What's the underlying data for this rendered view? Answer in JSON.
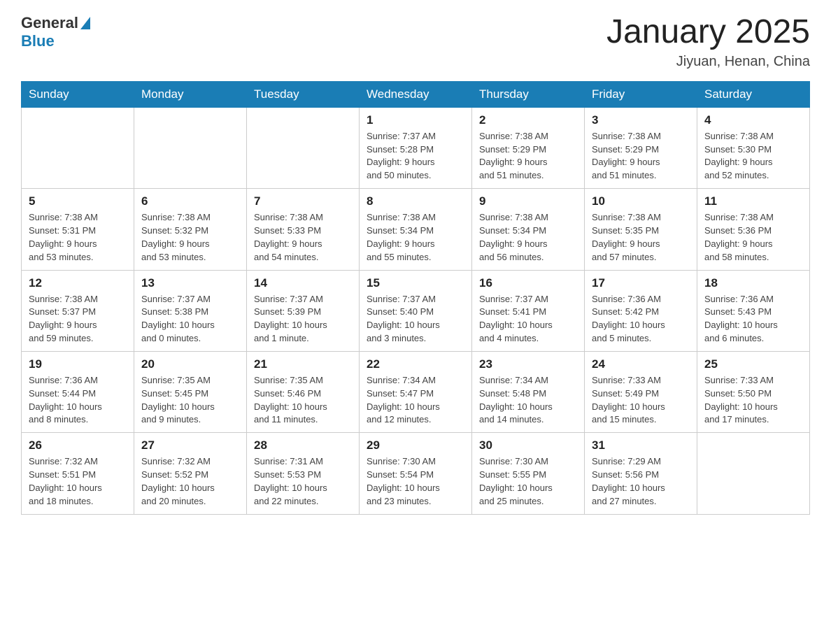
{
  "header": {
    "logo_general": "General",
    "logo_blue": "Blue",
    "title": "January 2025",
    "subtitle": "Jiyuan, Henan, China"
  },
  "weekdays": [
    "Sunday",
    "Monday",
    "Tuesday",
    "Wednesday",
    "Thursday",
    "Friday",
    "Saturday"
  ],
  "weeks": [
    [
      {
        "day": "",
        "info": ""
      },
      {
        "day": "",
        "info": ""
      },
      {
        "day": "",
        "info": ""
      },
      {
        "day": "1",
        "info": "Sunrise: 7:37 AM\nSunset: 5:28 PM\nDaylight: 9 hours\nand 50 minutes."
      },
      {
        "day": "2",
        "info": "Sunrise: 7:38 AM\nSunset: 5:29 PM\nDaylight: 9 hours\nand 51 minutes."
      },
      {
        "day": "3",
        "info": "Sunrise: 7:38 AM\nSunset: 5:29 PM\nDaylight: 9 hours\nand 51 minutes."
      },
      {
        "day": "4",
        "info": "Sunrise: 7:38 AM\nSunset: 5:30 PM\nDaylight: 9 hours\nand 52 minutes."
      }
    ],
    [
      {
        "day": "5",
        "info": "Sunrise: 7:38 AM\nSunset: 5:31 PM\nDaylight: 9 hours\nand 53 minutes."
      },
      {
        "day": "6",
        "info": "Sunrise: 7:38 AM\nSunset: 5:32 PM\nDaylight: 9 hours\nand 53 minutes."
      },
      {
        "day": "7",
        "info": "Sunrise: 7:38 AM\nSunset: 5:33 PM\nDaylight: 9 hours\nand 54 minutes."
      },
      {
        "day": "8",
        "info": "Sunrise: 7:38 AM\nSunset: 5:34 PM\nDaylight: 9 hours\nand 55 minutes."
      },
      {
        "day": "9",
        "info": "Sunrise: 7:38 AM\nSunset: 5:34 PM\nDaylight: 9 hours\nand 56 minutes."
      },
      {
        "day": "10",
        "info": "Sunrise: 7:38 AM\nSunset: 5:35 PM\nDaylight: 9 hours\nand 57 minutes."
      },
      {
        "day": "11",
        "info": "Sunrise: 7:38 AM\nSunset: 5:36 PM\nDaylight: 9 hours\nand 58 minutes."
      }
    ],
    [
      {
        "day": "12",
        "info": "Sunrise: 7:38 AM\nSunset: 5:37 PM\nDaylight: 9 hours\nand 59 minutes."
      },
      {
        "day": "13",
        "info": "Sunrise: 7:37 AM\nSunset: 5:38 PM\nDaylight: 10 hours\nand 0 minutes."
      },
      {
        "day": "14",
        "info": "Sunrise: 7:37 AM\nSunset: 5:39 PM\nDaylight: 10 hours\nand 1 minute."
      },
      {
        "day": "15",
        "info": "Sunrise: 7:37 AM\nSunset: 5:40 PM\nDaylight: 10 hours\nand 3 minutes."
      },
      {
        "day": "16",
        "info": "Sunrise: 7:37 AM\nSunset: 5:41 PM\nDaylight: 10 hours\nand 4 minutes."
      },
      {
        "day": "17",
        "info": "Sunrise: 7:36 AM\nSunset: 5:42 PM\nDaylight: 10 hours\nand 5 minutes."
      },
      {
        "day": "18",
        "info": "Sunrise: 7:36 AM\nSunset: 5:43 PM\nDaylight: 10 hours\nand 6 minutes."
      }
    ],
    [
      {
        "day": "19",
        "info": "Sunrise: 7:36 AM\nSunset: 5:44 PM\nDaylight: 10 hours\nand 8 minutes."
      },
      {
        "day": "20",
        "info": "Sunrise: 7:35 AM\nSunset: 5:45 PM\nDaylight: 10 hours\nand 9 minutes."
      },
      {
        "day": "21",
        "info": "Sunrise: 7:35 AM\nSunset: 5:46 PM\nDaylight: 10 hours\nand 11 minutes."
      },
      {
        "day": "22",
        "info": "Sunrise: 7:34 AM\nSunset: 5:47 PM\nDaylight: 10 hours\nand 12 minutes."
      },
      {
        "day": "23",
        "info": "Sunrise: 7:34 AM\nSunset: 5:48 PM\nDaylight: 10 hours\nand 14 minutes."
      },
      {
        "day": "24",
        "info": "Sunrise: 7:33 AM\nSunset: 5:49 PM\nDaylight: 10 hours\nand 15 minutes."
      },
      {
        "day": "25",
        "info": "Sunrise: 7:33 AM\nSunset: 5:50 PM\nDaylight: 10 hours\nand 17 minutes."
      }
    ],
    [
      {
        "day": "26",
        "info": "Sunrise: 7:32 AM\nSunset: 5:51 PM\nDaylight: 10 hours\nand 18 minutes."
      },
      {
        "day": "27",
        "info": "Sunrise: 7:32 AM\nSunset: 5:52 PM\nDaylight: 10 hours\nand 20 minutes."
      },
      {
        "day": "28",
        "info": "Sunrise: 7:31 AM\nSunset: 5:53 PM\nDaylight: 10 hours\nand 22 minutes."
      },
      {
        "day": "29",
        "info": "Sunrise: 7:30 AM\nSunset: 5:54 PM\nDaylight: 10 hours\nand 23 minutes."
      },
      {
        "day": "30",
        "info": "Sunrise: 7:30 AM\nSunset: 5:55 PM\nDaylight: 10 hours\nand 25 minutes."
      },
      {
        "day": "31",
        "info": "Sunrise: 7:29 AM\nSunset: 5:56 PM\nDaylight: 10 hours\nand 27 minutes."
      },
      {
        "day": "",
        "info": ""
      }
    ]
  ]
}
